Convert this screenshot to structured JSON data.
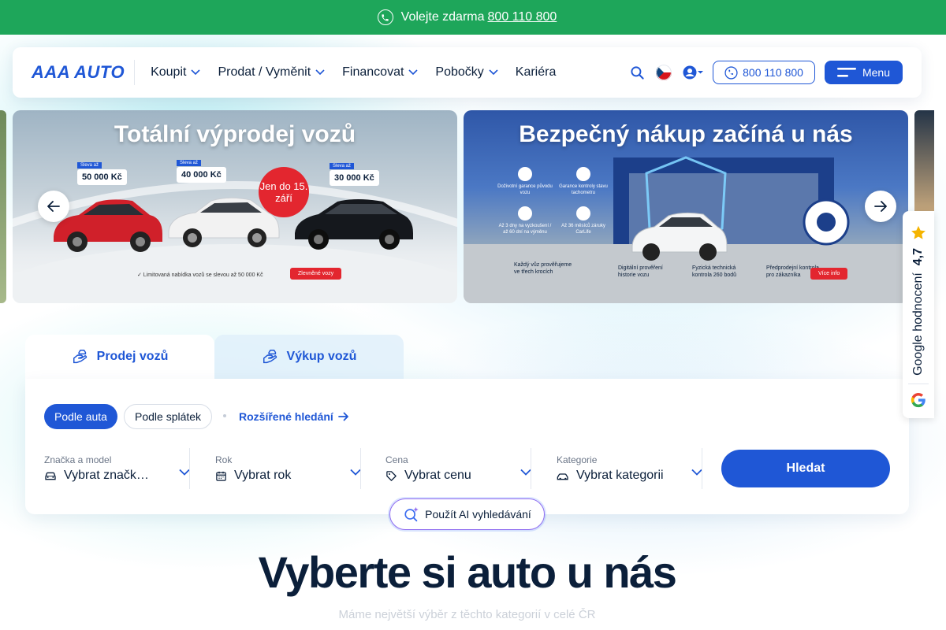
{
  "topbar": {
    "text": "Volejte zdarma",
    "phone": "800 110 800",
    "bg_color": "#1ea65a"
  },
  "header": {
    "logo": "AAA AUTO",
    "nav": [
      {
        "label": "Koupit",
        "has_dropdown": true
      },
      {
        "label": "Prodat / Vyměnit",
        "has_dropdown": true
      },
      {
        "label": "Financovat",
        "has_dropdown": true
      },
      {
        "label": "Pobočky",
        "has_dropdown": true
      },
      {
        "label": "Kariéra",
        "has_dropdown": false
      }
    ],
    "phone_button": "800 110 800",
    "menu_button": "Menu",
    "accent_color": "#1f57d6"
  },
  "banners": [
    {
      "title": "Totální výprodej vozů",
      "prices": [
        {
          "tag": "Sleva až",
          "amount": "50 000 Kč"
        },
        {
          "tag": "Sleva až",
          "amount": "40 000 Kč"
        },
        {
          "tag": "Sleva až",
          "amount": "30 000 Kč"
        }
      ],
      "date_badge": "Jen do 15. září",
      "footnote": "✓ Limitovaná nabídka vozů se slevou až 50 000 Kč",
      "cta": "Zlevněné vozy"
    },
    {
      "title": "Bezpečný nákup začíná u nás",
      "features": [
        "Doživotní garance původu vozu",
        "Garance kontroly stavu tachometru",
        "Až 3 dny na vyzkoušení / až 60 dní na výměnu",
        "Až 36 měsíců záruky CarLife"
      ],
      "steps": [
        "Každý vůz prověřujeme ve třech krocích",
        "Digitální prověření historie vozu",
        "Fyzická technická kontrola 260 bodů",
        "Předprodejní kontrola pro zákazníka"
      ],
      "cta": "Více info",
      "seal": "CERTIFIKOVANÝ BEZPEČNÝ NÁKUP VOZU"
    }
  ],
  "google_rating": {
    "label": "Google hodnocení",
    "score": "4,7"
  },
  "search": {
    "tabs": [
      {
        "label": "Prodej vozů",
        "active": true
      },
      {
        "label": "Výkup vozů",
        "active": false
      }
    ],
    "modes": [
      {
        "label": "Podle auta",
        "active": true
      },
      {
        "label": "Podle splátek",
        "active": false
      }
    ],
    "advanced_link": "Rozšířené hledání",
    "fields": [
      {
        "label": "Značka a model",
        "value": "Vybrat značk…",
        "icon": "car-icon"
      },
      {
        "label": "Rok",
        "value": "Vybrat rok",
        "icon": "calendar-icon"
      },
      {
        "label": "Cena",
        "value": "Vybrat cenu",
        "icon": "price-tag-icon"
      },
      {
        "label": "Kategorie",
        "value": "Vybrat kategorii",
        "icon": "car-category-icon"
      }
    ],
    "submit": "Hledat",
    "ai_button": "Použít AI vyhledávání"
  },
  "section": {
    "title": "Vyberte si auto u nás",
    "subtitle": "Máme největší výběr z těchto kategorií v celé ČR"
  }
}
